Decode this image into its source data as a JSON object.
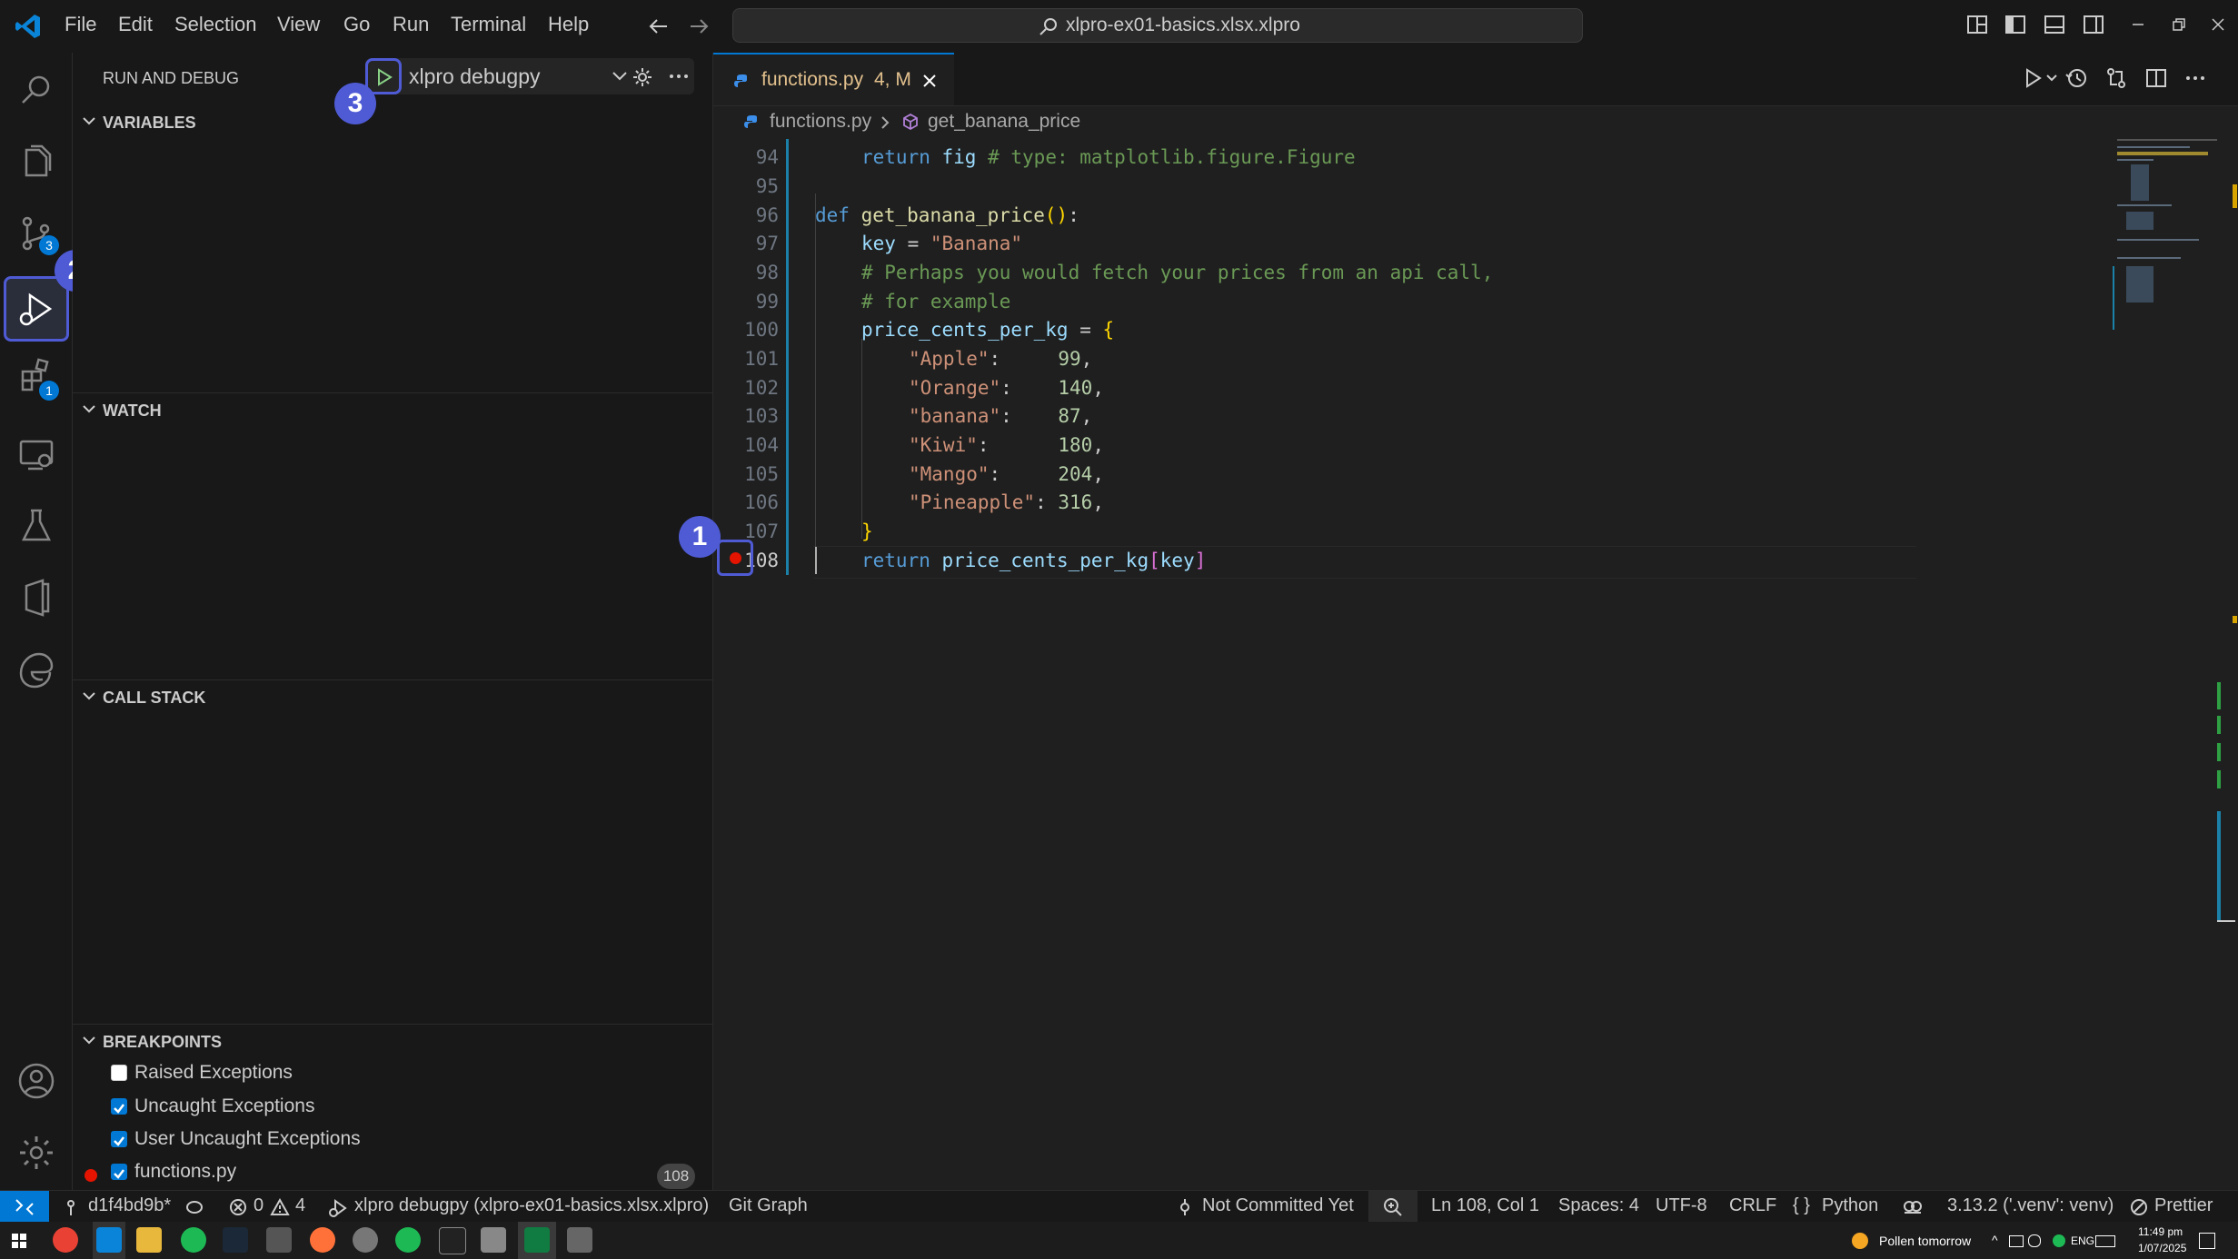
{
  "menu": [
    "File",
    "Edit",
    "Selection",
    "View",
    "Go",
    "Run",
    "Terminal",
    "Help"
  ],
  "command_center": {
    "text": "xlpro-ex01-basics.xlsx.xlpro"
  },
  "activity_badges": {
    "source_control": "3",
    "extensions": "1"
  },
  "callouts": {
    "one": "1",
    "two": "2",
    "three": "3"
  },
  "sidebar": {
    "title": "RUN AND DEBUG",
    "config": "xlpro debugpy",
    "sections": {
      "variables": "VARIABLES",
      "watch": "WATCH",
      "call_stack": "CALL STACK",
      "breakpoints": "BREAKPOINTS"
    },
    "breakpoints": [
      {
        "label": "Raised Exceptions",
        "checked": false
      },
      {
        "label": "Uncaught Exceptions",
        "checked": true
      },
      {
        "label": "User Uncaught Exceptions",
        "checked": true
      },
      {
        "label": "functions.py",
        "checked": true,
        "line": "108"
      }
    ]
  },
  "tab": {
    "name": "functions.py",
    "status": "4, M"
  },
  "breadcrumb": {
    "file": "functions.py",
    "symbol": "get_banana_price"
  },
  "code": {
    "line_numbers": [
      "94",
      "95",
      "96",
      "97",
      "98",
      "99",
      "100",
      "101",
      "102",
      "103",
      "104",
      "105",
      "106",
      "107",
      "108"
    ],
    "l94": {
      "kw": "return",
      "var": "fig",
      "cm": "# type: matplotlib.figure.Figure"
    },
    "l96": {
      "kw": "def",
      "fn": "get_banana_price",
      "paren": "()",
      "colon": ":"
    },
    "l97": {
      "var": "key",
      "op": " = ",
      "str": "\"Banana\""
    },
    "l98": {
      "cm": "# Perhaps you would fetch your prices from an api call,"
    },
    "l99": {
      "cm": "# for example"
    },
    "l100": {
      "var": "price_cents_per_kg",
      "op": " = ",
      "br": "{"
    },
    "dict": [
      {
        "key": "\"Apple\"",
        "pad": ":     ",
        "val": "99"
      },
      {
        "key": "\"Orange\"",
        "pad": ":    ",
        "val": "140"
      },
      {
        "key": "\"banana\"",
        "pad": ":    ",
        "val": "87"
      },
      {
        "key": "\"Kiwi\"",
        "pad": ":      ",
        "val": "180"
      },
      {
        "key": "\"Mango\"",
        "pad": ":     ",
        "val": "204"
      },
      {
        "key": "\"Pineapple\"",
        "pad": ": ",
        "val": "316"
      }
    ],
    "comma": ",",
    "l107": {
      "br": "}"
    },
    "l108": {
      "kw": "return",
      "var": "price_cents_per_kg",
      "lb": "[",
      "key": "key",
      "rb": "]"
    }
  },
  "status": {
    "branch": "d1f4bd9b*",
    "errors": "0",
    "warnings": "4",
    "debug": "xlpro debugpy (xlpro-ex01-basics.xlsx.xlpro)",
    "git_graph": "Git Graph",
    "blame": "Not Committed Yet",
    "position": "Ln 108, Col 1",
    "spaces": "Spaces: 4",
    "encoding": "UTF-8",
    "eol": "CRLF",
    "language": "Python",
    "interpreter": "3.13.2 ('.venv': venv)",
    "formatter": "Prettier"
  },
  "taskbar": {
    "weather": "Pollen tomorrow",
    "lang": "ENG",
    "time": "11:49 pm",
    "date": "1/07/2025"
  },
  "colors": {
    "accent": "#0078d4",
    "callout": "#4f5bd5",
    "breakpoint": "#e51400"
  }
}
